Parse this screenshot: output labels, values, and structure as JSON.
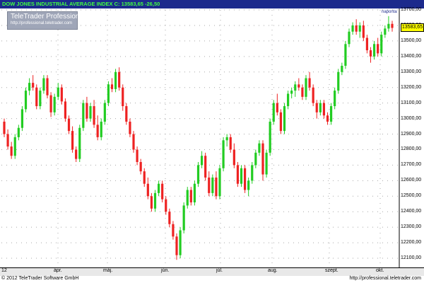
{
  "header": {
    "ticker_label": "DOW JONES INDUSTRIAL AVERAGE INDEX",
    "close_label": "C: 13583,65",
    "change_label": "-26,50",
    "period_label": "naponta"
  },
  "logo": {
    "title": "TeleTrader Professional",
    "url": "http://professional.teletrader.com"
  },
  "footer": {
    "copyright": "© 2012 TeleTrader Software GmbH",
    "url": "http://professional.teletrader.com"
  },
  "colors": {
    "up": "#22cc22",
    "down": "#ee2222",
    "grid": "#a8a8a8",
    "header_bg": "#1c2a8c",
    "last_price_bg": "#ffff00"
  },
  "chart_data": {
    "type": "candlestick",
    "title": "DOW JONES INDUSTRIAL AVERAGE INDEX",
    "ylim": [
      12050,
      13700
    ],
    "y_ticks": [
      12100,
      12200,
      12300,
      12400,
      12500,
      12600,
      12700,
      12800,
      12900,
      13000,
      13100,
      13200,
      13300,
      13400,
      13500,
      13600,
      13700
    ],
    "y_tick_labels": [
      "12100,00",
      "12200,00",
      "12300,00",
      "12400,00",
      "12500,00",
      "12600,00",
      "12700,00",
      "12800,00",
      "12900,00",
      "13000,00",
      "13100,00",
      "13200,00",
      "13300,00",
      "13400,00",
      "13500,00",
      "13600,00",
      "13700,00"
    ],
    "x_tick_labels": [
      "12",
      "ápr.",
      "máj.",
      "jún.",
      "júl.",
      "aug.",
      "szept.",
      "okt."
    ],
    "last_price": "13583,65",
    "grid": true,
    "legend": "none",
    "candles": [
      [
        12980,
        13000,
        12880,
        12900
      ],
      [
        12900,
        12930,
        12800,
        12820
      ],
      [
        12820,
        12850,
        12740,
        12760
      ],
      [
        12760,
        12900,
        12740,
        12880
      ],
      [
        12880,
        12960,
        12860,
        12940
      ],
      [
        12940,
        13080,
        12920,
        13060
      ],
      [
        13060,
        13200,
        13040,
        13180
      ],
      [
        13180,
        13260,
        13150,
        13230
      ],
      [
        13230,
        13280,
        13180,
        13200
      ],
      [
        13200,
        13220,
        13060,
        13080
      ],
      [
        13080,
        13200,
        13060,
        13180
      ],
      [
        13180,
        13280,
        13160,
        13260
      ],
      [
        13260,
        13280,
        13130,
        13150
      ],
      [
        13150,
        13170,
        13010,
        13040
      ],
      [
        13040,
        13160,
        13020,
        13140
      ],
      [
        13140,
        13230,
        13120,
        13200
      ],
      [
        13200,
        13220,
        13090,
        13110
      ],
      [
        13110,
        13130,
        12980,
        13000
      ],
      [
        13000,
        13020,
        12900,
        12920
      ],
      [
        12920,
        12950,
        12780,
        12800
      ],
      [
        12800,
        12820,
        12720,
        12740
      ],
      [
        12740,
        12960,
        12720,
        12940
      ],
      [
        12940,
        13120,
        12920,
        13100
      ],
      [
        13100,
        13140,
        12980,
        13000
      ],
      [
        13000,
        13100,
        12980,
        13080
      ],
      [
        13080,
        13120,
        12940,
        12960
      ],
      [
        12960,
        13020,
        12860,
        12880
      ],
      [
        12880,
        13000,
        12860,
        12980
      ],
      [
        12980,
        13120,
        12960,
        13100
      ],
      [
        13100,
        13240,
        13080,
        13220
      ],
      [
        13220,
        13260,
        13170,
        13190
      ],
      [
        13190,
        13320,
        13170,
        13300
      ],
      [
        13300,
        13330,
        13180,
        13200
      ],
      [
        13200,
        13220,
        13050,
        13080
      ],
      [
        13080,
        13100,
        12960,
        12980
      ],
      [
        12980,
        13000,
        12880,
        12900
      ],
      [
        12900,
        12920,
        12780,
        12800
      ],
      [
        12800,
        12820,
        12700,
        12720
      ],
      [
        12720,
        12740,
        12640,
        12660
      ],
      [
        12660,
        12680,
        12560,
        12580
      ],
      [
        12580,
        12620,
        12480,
        12500
      ],
      [
        12500,
        12520,
        12400,
        12420
      ],
      [
        12420,
        12540,
        12400,
        12520
      ],
      [
        12520,
        12600,
        12500,
        12580
      ],
      [
        12580,
        12600,
        12460,
        12480
      ],
      [
        12480,
        12500,
        12380,
        12400
      ],
      [
        12400,
        12420,
        12300,
        12320
      ],
      [
        12320,
        12340,
        12220,
        12240
      ],
      [
        12240,
        12260,
        12090,
        12120
      ],
      [
        12120,
        12300,
        12100,
        12280
      ],
      [
        12280,
        12460,
        12260,
        12440
      ],
      [
        12440,
        12560,
        12420,
        12540
      ],
      [
        12540,
        12560,
        12440,
        12460
      ],
      [
        12460,
        12600,
        12440,
        12580
      ],
      [
        12580,
        12720,
        12560,
        12700
      ],
      [
        12700,
        12790,
        12680,
        12760
      ],
      [
        12760,
        12780,
        12600,
        12620
      ],
      [
        12620,
        12660,
        12500,
        12520
      ],
      [
        12520,
        12640,
        12500,
        12620
      ],
      [
        12620,
        12660,
        12480,
        12500
      ],
      [
        12500,
        12700,
        12480,
        12680
      ],
      [
        12680,
        12880,
        12660,
        12860
      ],
      [
        12860,
        12900,
        12820,
        12880
      ],
      [
        12880,
        12900,
        12780,
        12800
      ],
      [
        12800,
        12840,
        12680,
        12700
      ],
      [
        12700,
        12720,
        12560,
        12580
      ],
      [
        12580,
        12700,
        12560,
        12680
      ],
      [
        12680,
        12700,
        12520,
        12540
      ],
      [
        12540,
        12620,
        12500,
        12600
      ],
      [
        12600,
        12720,
        12580,
        12700
      ],
      [
        12700,
        12800,
        12680,
        12780
      ],
      [
        12780,
        12860,
        12760,
        12840
      ],
      [
        12840,
        12860,
        12600,
        12640
      ],
      [
        12640,
        12800,
        12620,
        12780
      ],
      [
        12780,
        13000,
        12760,
        12980
      ],
      [
        12980,
        13120,
        12960,
        13100
      ],
      [
        13100,
        13160,
        13020,
        13040
      ],
      [
        13040,
        13060,
        12900,
        12920
      ],
      [
        12920,
        13100,
        12900,
        13080
      ],
      [
        13080,
        13180,
        13060,
        13160
      ],
      [
        13160,
        13200,
        13130,
        13180
      ],
      [
        13180,
        13240,
        13140,
        13220
      ],
      [
        13220,
        13260,
        13180,
        13200
      ],
      [
        13200,
        13220,
        13120,
        13140
      ],
      [
        13140,
        13280,
        13120,
        13260
      ],
      [
        13260,
        13300,
        13180,
        13200
      ],
      [
        13200,
        13220,
        13080,
        13100
      ],
      [
        13100,
        13120,
        13000,
        13040
      ],
      [
        13040,
        13120,
        13020,
        13100
      ],
      [
        13100,
        13120,
        13000,
        13020
      ],
      [
        13020,
        13040,
        12960,
        12980
      ],
      [
        12980,
        13100,
        12960,
        13080
      ],
      [
        13080,
        13200,
        13060,
        13180
      ],
      [
        13180,
        13320,
        13160,
        13300
      ],
      [
        13300,
        13360,
        13280,
        13340
      ],
      [
        13340,
        13500,
        13320,
        13480
      ],
      [
        13480,
        13580,
        13460,
        13560
      ],
      [
        13560,
        13620,
        13540,
        13600
      ],
      [
        13600,
        13640,
        13540,
        13560
      ],
      [
        13560,
        13620,
        13520,
        13600
      ],
      [
        13600,
        13630,
        13500,
        13520
      ],
      [
        13520,
        13540,
        13420,
        13440
      ],
      [
        13440,
        13460,
        13360,
        13400
      ],
      [
        13400,
        13500,
        13380,
        13480
      ],
      [
        13480,
        13520,
        13400,
        13420
      ],
      [
        13420,
        13560,
        13400,
        13540
      ],
      [
        13540,
        13600,
        13520,
        13580
      ],
      [
        13580,
        13660,
        13560,
        13610
      ],
      [
        13610,
        13630,
        13560,
        13584
      ]
    ]
  }
}
